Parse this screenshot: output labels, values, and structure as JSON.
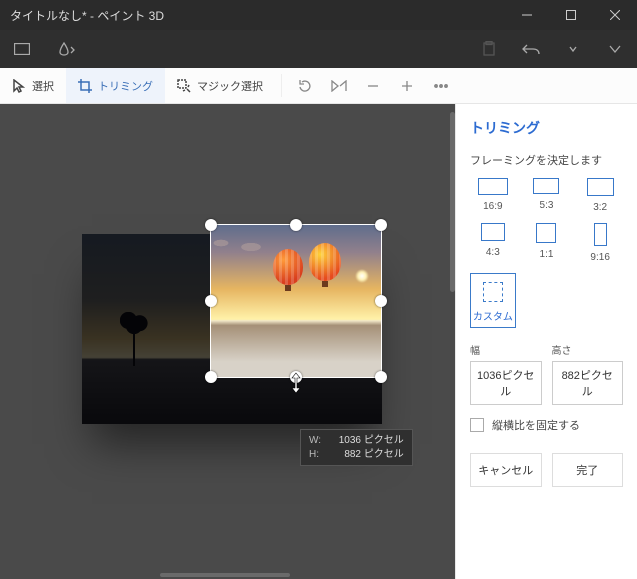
{
  "titlebar": {
    "title": "タイトルなし* - ペイント 3D"
  },
  "tooltabs": {
    "select": "選択",
    "crop": "トリミング",
    "magic": "マジック選択"
  },
  "dim_tip": {
    "w_label": "W:",
    "w_value": "1036",
    "w_unit": "ピクセル",
    "h_label": "H:",
    "h_value": "882",
    "h_unit": "ピクセル"
  },
  "side": {
    "title": "トリミング",
    "framing_caption": "フレーミングを決定します",
    "ratios": {
      "r169": "16:9",
      "r53": "5:3",
      "r32": "3:2",
      "r43": "4:3",
      "r11": "1:1",
      "r916": "9:16"
    },
    "custom_label": "カスタム",
    "width_label": "幅",
    "height_label": "高さ",
    "width_value": "1036ピクセル",
    "height_value": "882ピクセル",
    "lock_label": "縦横比を固定する",
    "cancel": "キャンセル",
    "done": "完了"
  }
}
